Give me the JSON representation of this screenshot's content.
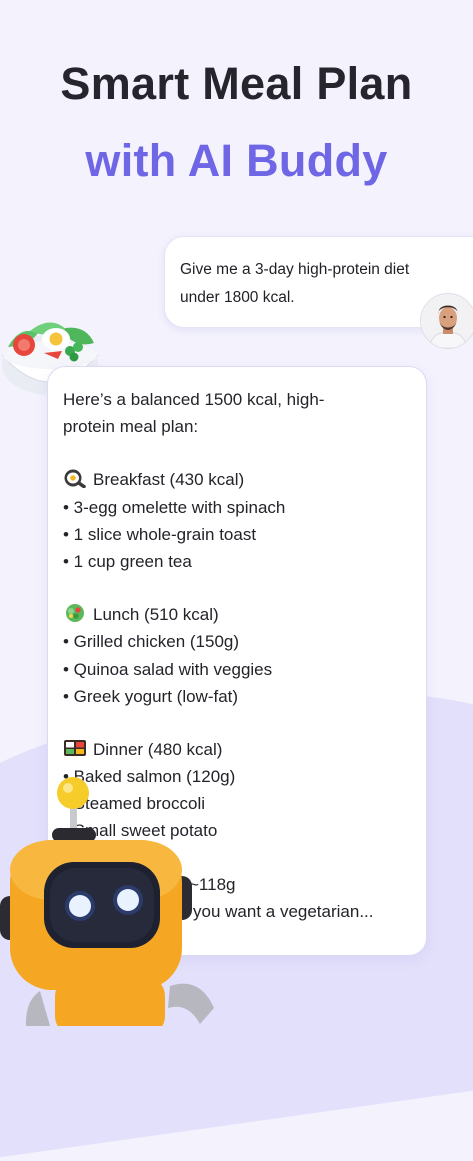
{
  "headline": {
    "line1": "Smart Meal Plan",
    "line2": "with AI Buddy"
  },
  "user_message": {
    "line1": "Give me a 3-day high-protein diet",
    "line2": "under 1800 kcal."
  },
  "ai_message": {
    "intro_line1": "Here’s a balanced 1500 kcal, high-",
    "intro_line2": "protein meal plan:",
    "breakfast": {
      "icon": "fried-egg-icon",
      "title": "Breakfast (430 kcal)",
      "items": [
        "• 3-egg omelette with spinach",
        "• 1 slice whole-grain toast",
        "• 1 cup green tea"
      ]
    },
    "lunch": {
      "icon": "salad-icon",
      "title": "Lunch (510 kcal)",
      "items": [
        "• Grilled chicken (150g)",
        "• Quinoa salad with veggies",
        "• Greek yogurt (low-fat)"
      ]
    },
    "dinner": {
      "icon": "bento-box-icon",
      "title": "Dinner (480 kcal)",
      "items": [
        "• Baked salmon (120g)",
        "• Steamed broccoli",
        "• Small sweet potato"
      ]
    },
    "protein_partial": "~118g",
    "followup_partial": "you want a vegetarian..."
  },
  "colors": {
    "background": "#f3f2fd",
    "accent": "#6f66e6",
    "robot_body": "#f5a623"
  }
}
